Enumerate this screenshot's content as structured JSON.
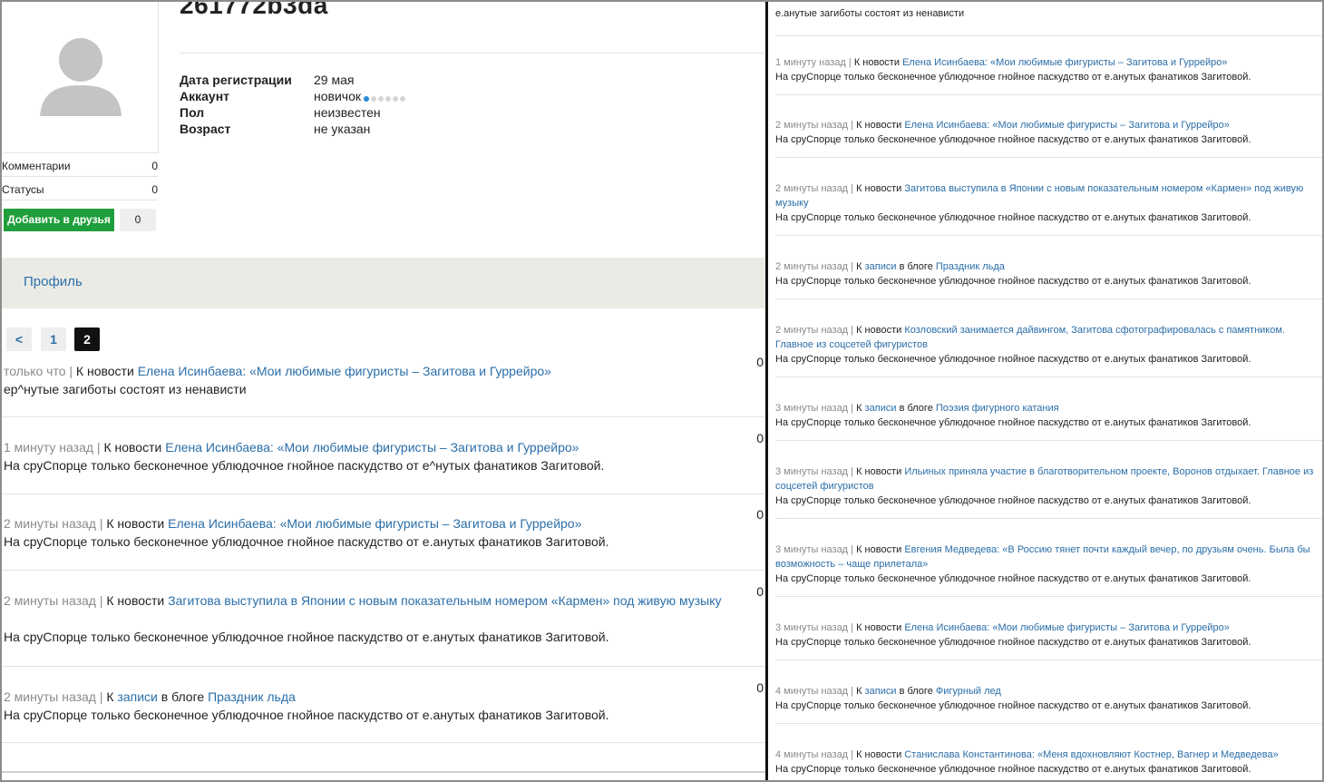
{
  "user": {
    "title": "261772b3da",
    "info": [
      {
        "key": "Дата регистрации",
        "value": "29 мая"
      },
      {
        "key": "Аккаунт",
        "value": "новичок"
      },
      {
        "key": "Пол",
        "value": "неизвестен"
      },
      {
        "key": "Возраст",
        "value": "не указан"
      }
    ],
    "level": {
      "filled": 1,
      "total": 6
    }
  },
  "stats": {
    "comments_label": "Комментарии",
    "comments_value": "0",
    "statuses_label": "Статусы",
    "statuses_value": "0"
  },
  "friends": {
    "add_label": "Добавить в друзья",
    "count": "0"
  },
  "tabs": {
    "profile": "Профиль"
  },
  "pagination": {
    "prev": "<",
    "pages": [
      "1",
      "2"
    ],
    "current": "2"
  },
  "left_feed": [
    {
      "time": "только что",
      "sep": " | ",
      "prefix": "К новости",
      "mid": "",
      "link": "Елена Исинбаева: «Мои любимые фигуристы – Загитова и Гуррейро»",
      "text": "ер^нутые загиботы состоят из ненависти",
      "count": "0"
    },
    {
      "time": "1 минуту назад",
      "sep": " | ",
      "prefix": "К новости",
      "mid": "",
      "link": "Елена Исинбаева: «Мои любимые фигуристы – Загитова и Гуррейро»",
      "text": "На сруСпорце только бесконечное ублюдочное гнойное паскудство от е^нутых фанатиков Загитовой.",
      "count": "0"
    },
    {
      "time": "2 минуты назад",
      "sep": " | ",
      "prefix": "К новости",
      "mid": "",
      "link": "Елена Исинбаева: «Мои любимые фигуристы – Загитова и Гуррейро»",
      "text": "На сруСпорце только бесконечное ублюдочное гнойное паскудство от е.анутых фанатиков Загитовой.",
      "count": "0"
    },
    {
      "time": "2 минуты назад",
      "sep": " | ",
      "prefix": "К новости",
      "mid": "",
      "link": "Загитова выступила в Японии с новым показательным номером «Кармен» под живую музыку",
      "text": "На сруСпорце только бесконечное ублюдочное гнойное паскудство от е.анутых фанатиков Загитовой.",
      "count": "0"
    },
    {
      "time": "2 минуты назад",
      "sep": " | ",
      "prefix": "К",
      "mid_link": "записи",
      "mid": "в блоге",
      "link": "Праздник льда",
      "text": "На сруСпорце только бесконечное ублюдочное гнойное паскудство от е.анутых фанатиков Загитовой.",
      "count": "0"
    }
  ],
  "right_feed": [
    {
      "time": "",
      "sep": "",
      "prefix": "",
      "link": "",
      "text": "е.анутые загиботы состоят из ненависти"
    },
    {
      "time": "1 минуту назад",
      "sep": " | ",
      "prefix": "К новости",
      "link": "Елена Исинбаева: «Мои любимые фигуристы – Загитова и Гуррейро»",
      "text": "На сруСпорце только бесконечное ублюдочное гнойное паскудство от е.анутых фанатиков Загитовой."
    },
    {
      "time": "2 минуты назад",
      "sep": " | ",
      "prefix": "К новости",
      "link": "Елена Исинбаева: «Мои любимые фигуристы – Загитова и Гуррейро»",
      "text": "На сруСпорце только бесконечное ублюдочное гнойное паскудство от е.анутых фанатиков Загитовой."
    },
    {
      "time": "2 минуты назад",
      "sep": " | ",
      "prefix": "К новости",
      "link": "Загитова выступила в Японии с новым показательным номером «Кармен» под живую музыку",
      "text": "На сруСпорце только бесконечное ублюдочное гнойное паскудство от е.анутых фанатиков Загитовой."
    },
    {
      "time": "2 минуты назад",
      "sep": " | ",
      "prefix": "К",
      "mid_link": "записи",
      "mid": "в блоге",
      "link": "Праздник льда",
      "text": "На сруСпорце только бесконечное ублюдочное гнойное паскудство от е.анутых фанатиков Загитовой."
    },
    {
      "time": "2 минуты назад",
      "sep": " | ",
      "prefix": "К новости",
      "link": "Козловский занимается дайвингом, Загитова сфотографировалась с памятником. Главное из соцсетей фигуристов",
      "text": "На сруСпорце только бесконечное ублюдочное гнойное паскудство от е.анутых фанатиков Загитовой."
    },
    {
      "time": "3 минуты назад",
      "sep": " | ",
      "prefix": "К",
      "mid_link": "записи",
      "mid": "в блоге",
      "link": "Поэзия фигурного катания",
      "text": "На сруСпорце только бесконечное ублюдочное гнойное паскудство от е.анутых фанатиков Загитовой."
    },
    {
      "time": "3 минуты назад",
      "sep": " | ",
      "prefix": "К новости",
      "link": "Ильиных приняла участие в благотворительном проекте, Воронов отдыхает. Главное из соцсетей фигуристов",
      "text": "На сруСпорце только бесконечное ублюдочное гнойное паскудство от е.анутых фанатиков Загитовой."
    },
    {
      "time": "3 минуты назад",
      "sep": " | ",
      "prefix": "К новости",
      "link": "Евгения Медведева: «В Россию тянет почти каждый вечер, по друзьям очень. Была бы возможность – чаще прилетала»",
      "text": "На сруСпорце только бесконечное ублюдочное гнойное паскудство от е.анутых фанатиков Загитовой."
    },
    {
      "time": "3 минуты назад",
      "sep": " | ",
      "prefix": "К новости",
      "link": "Елена Исинбаева: «Мои любимые фигуристы – Загитова и Гуррейро»",
      "text": "На сруСпорце только бесконечное ублюдочное гнойное паскудство от е.анутых фанатиков Загитовой."
    },
    {
      "time": "4 минуты назад",
      "sep": " | ",
      "prefix": "К",
      "mid_link": "записи",
      "mid": "в блоге",
      "link": "Фигурный лед",
      "text": "На сруСпорце только бесконечное ублюдочное гнойное паскудство от е.анутых фанатиков Загитовой."
    },
    {
      "time": "4 минуты назад",
      "sep": " | ",
      "prefix": "К новости",
      "link": "Станислава Константинова: «Меня вдохновляют Костнер, Вагнер и Медведева»",
      "text": "На сруСпорце только бесконечное ублюдочное гнойное паскудство от е.анутых фанатиков Загитовой."
    }
  ]
}
